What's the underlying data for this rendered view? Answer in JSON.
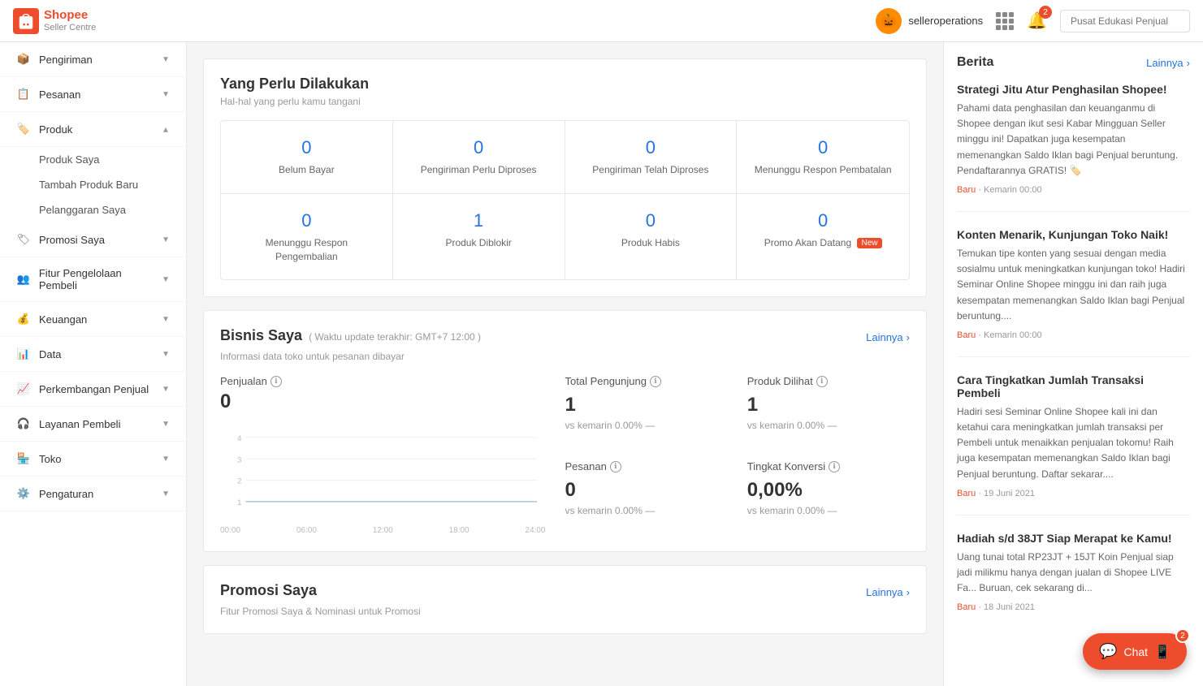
{
  "topnav": {
    "brand": "Shopee",
    "seller_centre": "Seller Centre",
    "username": "selleroperations",
    "notif_count": "2",
    "search_placeholder": "Pusat Edukasi Penjual"
  },
  "sidebar": {
    "items": [
      {
        "id": "pengiriman",
        "label": "Pengiriman",
        "icon": "box",
        "hasArrow": true,
        "expanded": false
      },
      {
        "id": "pesanan",
        "label": "Pesanan",
        "icon": "list",
        "hasArrow": true,
        "expanded": false
      },
      {
        "id": "produk",
        "label": "Produk",
        "icon": "tag",
        "hasArrow": true,
        "expanded": true,
        "subitems": [
          "Produk Saya",
          "Tambah Produk Baru",
          "Pelanggaran Saya"
        ]
      },
      {
        "id": "promosi",
        "label": "Promosi Saya",
        "icon": "percent",
        "hasArrow": true,
        "expanded": false
      },
      {
        "id": "fitur",
        "label": "Fitur Pengelolaan Pembeli",
        "icon": "users",
        "hasArrow": true,
        "expanded": false
      },
      {
        "id": "keuangan",
        "label": "Keuangan",
        "icon": "dollar",
        "hasArrow": true,
        "expanded": false
      },
      {
        "id": "data",
        "label": "Data",
        "icon": "chart",
        "hasArrow": true,
        "expanded": false
      },
      {
        "id": "perkembangan",
        "label": "Perkembangan Penjual",
        "icon": "growth",
        "hasArrow": true,
        "expanded": false
      },
      {
        "id": "layanan",
        "label": "Layanan Pembeli",
        "icon": "headset",
        "hasArrow": true,
        "expanded": false
      },
      {
        "id": "toko",
        "label": "Toko",
        "icon": "store",
        "hasArrow": true,
        "expanded": false
      },
      {
        "id": "pengaturan",
        "label": "Pengaturan",
        "icon": "gear",
        "hasArrow": true,
        "expanded": false
      }
    ]
  },
  "yang_perlu": {
    "title": "Yang Perlu Dilakukan",
    "subtitle": "Hal-hal yang perlu kamu tangani",
    "items": [
      {
        "number": "0",
        "label": "Belum Bayar"
      },
      {
        "number": "0",
        "label": "Pengiriman Perlu Diproses"
      },
      {
        "number": "0",
        "label": "Pengiriman Telah Diproses"
      },
      {
        "number": "0",
        "label": "Menunggu Respon Pembatalan"
      },
      {
        "number": "0",
        "label": "Menunggu Respon Pengembalian"
      },
      {
        "number": "1",
        "label": "Produk Diblokir"
      },
      {
        "number": "0",
        "label": "Produk Habis"
      },
      {
        "number": "0",
        "label": "Promo Akan Datang",
        "badge": "New"
      }
    ]
  },
  "bisnis_saya": {
    "title": "Bisnis Saya",
    "update_text": "( Waktu update terakhir: GMT+7 12:00 )",
    "subtitle": "Informasi data toko untuk pesanan dibayar",
    "lainnya": "Lainnya",
    "penjualan": {
      "label": "Penjualan",
      "value": "0",
      "time_labels": [
        "00:00",
        "06:00",
        "12:00",
        "18:00",
        "24:00"
      ]
    },
    "total_pengunjung": {
      "label": "Total Pengunjung",
      "value": "1",
      "compare": "vs kemarin 0.00% —"
    },
    "produk_dilihat": {
      "label": "Produk Dilihat",
      "value": "1",
      "compare": "vs kemarin 0.00% —"
    },
    "pesanan": {
      "label": "Pesanan",
      "value": "0",
      "compare": "vs kemarin 0.00% —"
    },
    "tingkat_konversi": {
      "label": "Tingkat Konversi",
      "value": "0,00%",
      "compare": "vs kemarin 0.00% —"
    }
  },
  "promosi_saya": {
    "title": "Promosi Saya",
    "lainnya": "Lainnya",
    "subtitle": "Fitur Promosi Saya & Nominasi untuk Promosi"
  },
  "berita": {
    "title": "Berita",
    "lainnya": "Lainnya",
    "items": [
      {
        "title": "Strategi Jitu Atur Penghasilan Shopee!",
        "body": "Pahami data penghasilan dan keuanganmu di Shopee dengan ikut sesi Kabar Mingguan Seller minggu ini! Dapatkan juga kesempatan memenangkan Saldo Iklan bagi Penjual beruntung. Pendaftarannya GRATIS! 🏷️",
        "meta": "Baru",
        "date": "· Kemarin 00:00"
      },
      {
        "title": "Konten Menarik, Kunjungan Toko Naik!",
        "body": "Temukan tipe konten yang sesuai dengan media sosialmu untuk meningkatkan kunjungan toko! Hadiri Seminar Online Shopee minggu ini dan raih juga kesempatan memenangkan Saldo Iklan bagi Penjual beruntung....",
        "meta": "Baru",
        "date": "· Kemarin 00:00"
      },
      {
        "title": "Cara Tingkatkan Jumlah Transaksi Pembeli",
        "body": "Hadiri sesi Seminar Online Shopee kali ini dan ketahui cara meningkatkan jumlah transaksi per Pembeli untuk menaikkan penjualan tokomu! Raih juga kesempatan memenangkan Saldo Iklan bagi Penjual beruntung. Daftar sekarar....",
        "meta": "Baru",
        "date": "· 19 Juni 2021"
      },
      {
        "title": "Hadiah s/d 38JT Siap Merapat ke Kamu!",
        "body": "Uang tunai total RP23JT + 15JT Koin Penjual siap jadi milikmu hanya dengan jualan di Shopee LIVE Fa... Buruan, cek sekarang di...",
        "meta": "Baru",
        "date": "· 18 Juni 2021"
      }
    ]
  },
  "chat": {
    "label": "Chat",
    "badge": "2"
  }
}
